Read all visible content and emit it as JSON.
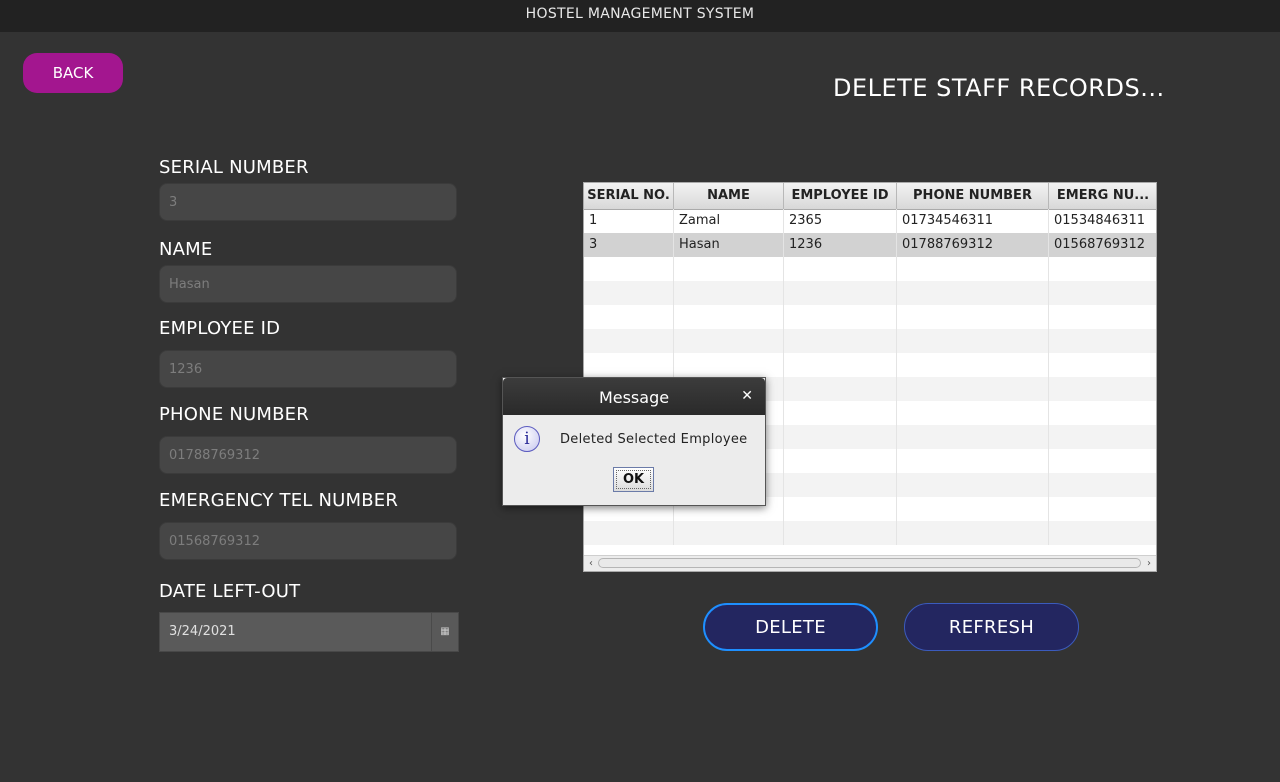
{
  "window": {
    "title": "HOSTEL MANAGEMENT SYSTEM"
  },
  "back_label": "BACK",
  "page_title": "DELETE STAFF RECORDS...",
  "form": {
    "serial": {
      "label": "SERIAL NUMBER",
      "value": "3"
    },
    "name": {
      "label": "NAME",
      "value": "Hasan"
    },
    "employee_id": {
      "label": "EMPLOYEE ID",
      "value": "1236"
    },
    "phone": {
      "label": "PHONE NUMBER",
      "value": "01788769312"
    },
    "emergency": {
      "label": "EMERGENCY TEL NUMBER",
      "value": "01568769312"
    },
    "date_left": {
      "label": "DATE LEFT-OUT",
      "value": "3/24/2021",
      "icon": "calendar-icon"
    }
  },
  "table": {
    "columns": [
      "SERIAL NO.",
      "NAME",
      "EMPLOYEE ID",
      "PHONE NUMBER",
      "EMERG NU..."
    ],
    "rows": [
      [
        "1",
        "Zamal",
        "2365",
        "01734546311",
        "01534846311"
      ],
      [
        "3",
        "Hasan",
        "1236",
        "01788769312",
        "01568769312"
      ]
    ],
    "selected_row": 1,
    "scroll_left_icon": "chevron-left-icon",
    "scroll_right_icon": "chevron-right-icon"
  },
  "buttons": {
    "delete": "DELETE",
    "refresh": "REFRESH"
  },
  "dialog": {
    "title": "Message",
    "close_icon": "close-icon",
    "icon": "info-icon",
    "message": "Deleted Selected Employee",
    "ok": "OK"
  },
  "colors": {
    "background": "#333333",
    "back_button": "#a3168f",
    "action_button": "#232660",
    "delete_border": "#1e8fff"
  }
}
